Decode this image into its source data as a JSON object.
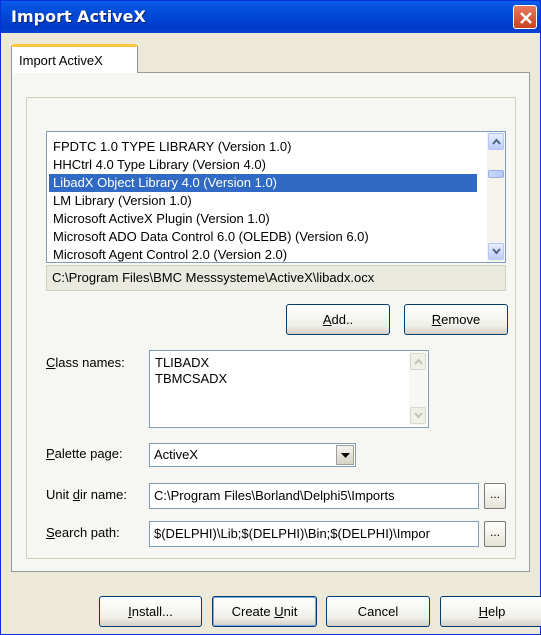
{
  "window": {
    "title": "Import ActiveX"
  },
  "tab": {
    "label": "Import ActiveX"
  },
  "library_list": {
    "items": [
      "FPDTC 1.0 TYPE LIBRARY (Version 1.0)",
      "HHCtrl 4.0 Type Library (Version 4.0)",
      "LibadX Object Library 4.0 (Version 1.0)",
      "LM Library (Version 1.0)",
      "Microsoft ActiveX Plugin (Version 1.0)",
      "Microsoft ADO Data Control 6.0 (OLEDB) (Version 6.0)",
      "Microsoft Agent Control 2.0 (Version 2.0)"
    ],
    "selected_index": 2
  },
  "file_path": "C:\\Program Files\\BMC Messsysteme\\ActiveX\\libadx.ocx",
  "buttons": {
    "add": {
      "pre": "",
      "accel": "A",
      "post": "dd.."
    },
    "remove": {
      "pre": "",
      "accel": "R",
      "post": "emove"
    },
    "install": {
      "pre": "",
      "accel": "I",
      "post": "nstall..."
    },
    "create_unit": {
      "pre": "Create ",
      "accel": "U",
      "post": "nit"
    },
    "cancel": {
      "label": "Cancel"
    },
    "help": {
      "pre": "",
      "accel": "H",
      "post": "elp"
    }
  },
  "class_names": {
    "label": {
      "pre": "",
      "accel": "C",
      "post": "lass names:"
    },
    "lines": [
      "TLIBADX",
      "TBMCSADX"
    ]
  },
  "palette_page": {
    "label": {
      "pre": "",
      "accel": "P",
      "post": "alette page:"
    },
    "value": "ActiveX"
  },
  "unit_dir": {
    "label": {
      "pre": "Unit ",
      "accel": "d",
      "post": "ir name:"
    },
    "value": "C:\\Program Files\\Borland\\Delphi5\\Imports",
    "browse": "..."
  },
  "search_path": {
    "label": {
      "pre": "",
      "accel": "S",
      "post": "earch path:"
    },
    "value": "$(DELPHI)\\Lib;$(DELPHI)\\Bin;$(DELPHI)\\Impor",
    "browse": "..."
  },
  "colors": {
    "title_bar": "#0054e3",
    "selection": "#316ac5",
    "face": "#ece9d8"
  }
}
